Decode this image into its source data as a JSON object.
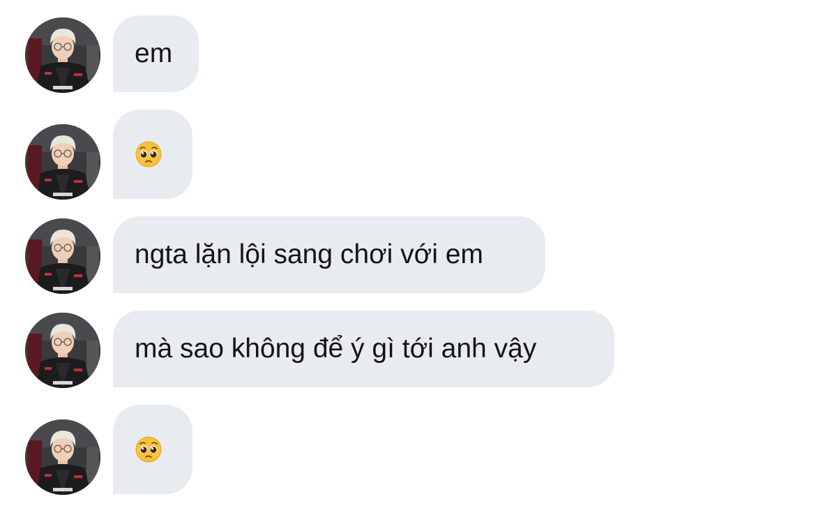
{
  "messages": [
    {
      "type": "text",
      "text": "em"
    },
    {
      "type": "emoji",
      "emoji_name": "pleading-face-emoji"
    },
    {
      "type": "text",
      "text": "ngta lặn lội sang chơi với em"
    },
    {
      "type": "text",
      "text": "mà sao không để ý gì tới anh vậy"
    },
    {
      "type": "emoji",
      "emoji_name": "pleading-face-emoji"
    }
  ],
  "colors": {
    "bubble_bg": "#e8ecf0",
    "text": "#141414",
    "emoji_face": "#f7c23a"
  },
  "icons": {
    "avatar": "user-avatar-photo"
  }
}
